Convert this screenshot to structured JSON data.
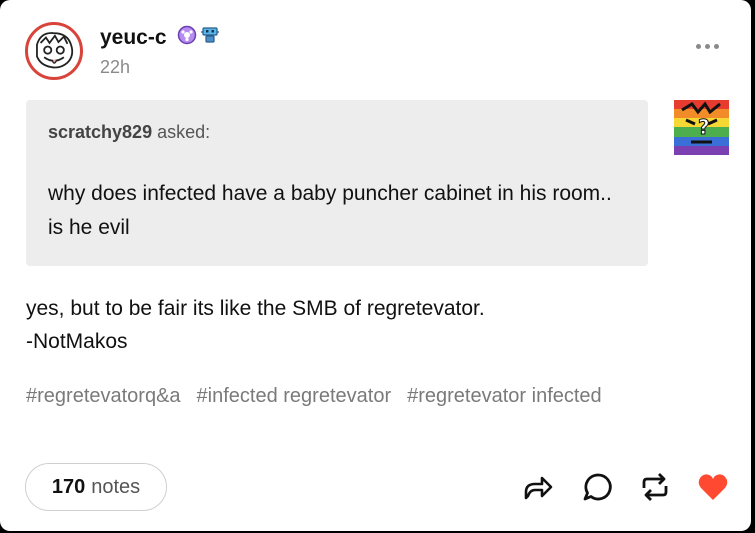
{
  "post": {
    "author": "yeuc-c",
    "time": "22h",
    "badges": [
      "purple-flower-badge",
      "blue-robot-badge"
    ]
  },
  "ask": {
    "asker": "scratchy829",
    "asked_label": "asked:",
    "question": "why does infected have a baby puncher cabinet in his room.. is he evil"
  },
  "answer": {
    "line1": "yes, but to be fair its like the SMB of regretevator.",
    "line2": "-NotMakos"
  },
  "tags": [
    "#regretevatorq&a",
    "#infected regretevator",
    "#regretevator infected"
  ],
  "footer": {
    "notes_count": "170",
    "notes_label": "notes"
  },
  "icons": {
    "more": "more-icon",
    "share": "share-icon",
    "reply": "reply-icon",
    "reblog": "reblog-icon",
    "like": "heart-icon"
  },
  "colors": {
    "like": "#ff4930",
    "avatar_ring": "#d9443a",
    "ask_background": "#ededed"
  }
}
